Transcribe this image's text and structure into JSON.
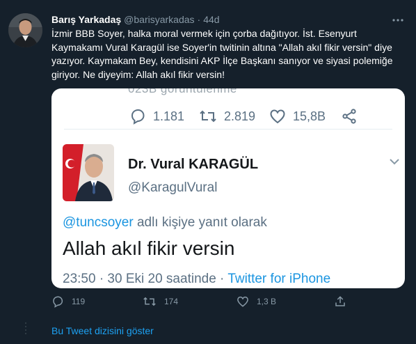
{
  "tweet": {
    "author_name": "Barış Yarkadaş",
    "author_handle": "@barisyarkadas",
    "separator": "·",
    "time": "44d",
    "text": "İzmir BBB Soyer, halka moral vermek için çorba dağıtıyor. İst. Esenyurt Kaymakamı Vural Karagül ise Soyer'in twitinin altına \"Allah akıl fikir versin\" diye yazıyor. Kaymakam Bey, kendisini AKP İlçe Başkanı sanıyor ve siyasi polemiğe giriyor. Ne diyeyim: Allah akıl fikir versin!",
    "actions": {
      "replies": "119",
      "retweets": "174",
      "likes": "1,3 B"
    },
    "show_thread": "Bu Tweet dizisini göster"
  },
  "screenshot": {
    "cut_text": "023B görüntülenme",
    "actions": {
      "replies": "1.181",
      "retweets": "2.819",
      "likes": "15,8B"
    },
    "author_name": "Dr. Vural KARAGÜL",
    "author_handle": "@KaragulVural",
    "reply_mention": "@tuncsoyer",
    "reply_suffix": " adlı kişiye yanıt olarak",
    "text": "Allah akıl fikir versin",
    "timestamp": "23:50 · 30 Eki 20 saatinde · ",
    "source": "Twitter for iPhone"
  },
  "colors": {
    "background": "#15202b",
    "accent": "#1da1f2",
    "muted": "#8899a6"
  },
  "icons": [
    "reply-icon",
    "retweet-icon",
    "like-icon",
    "share-icon",
    "more-icon",
    "chevron-down-icon"
  ]
}
